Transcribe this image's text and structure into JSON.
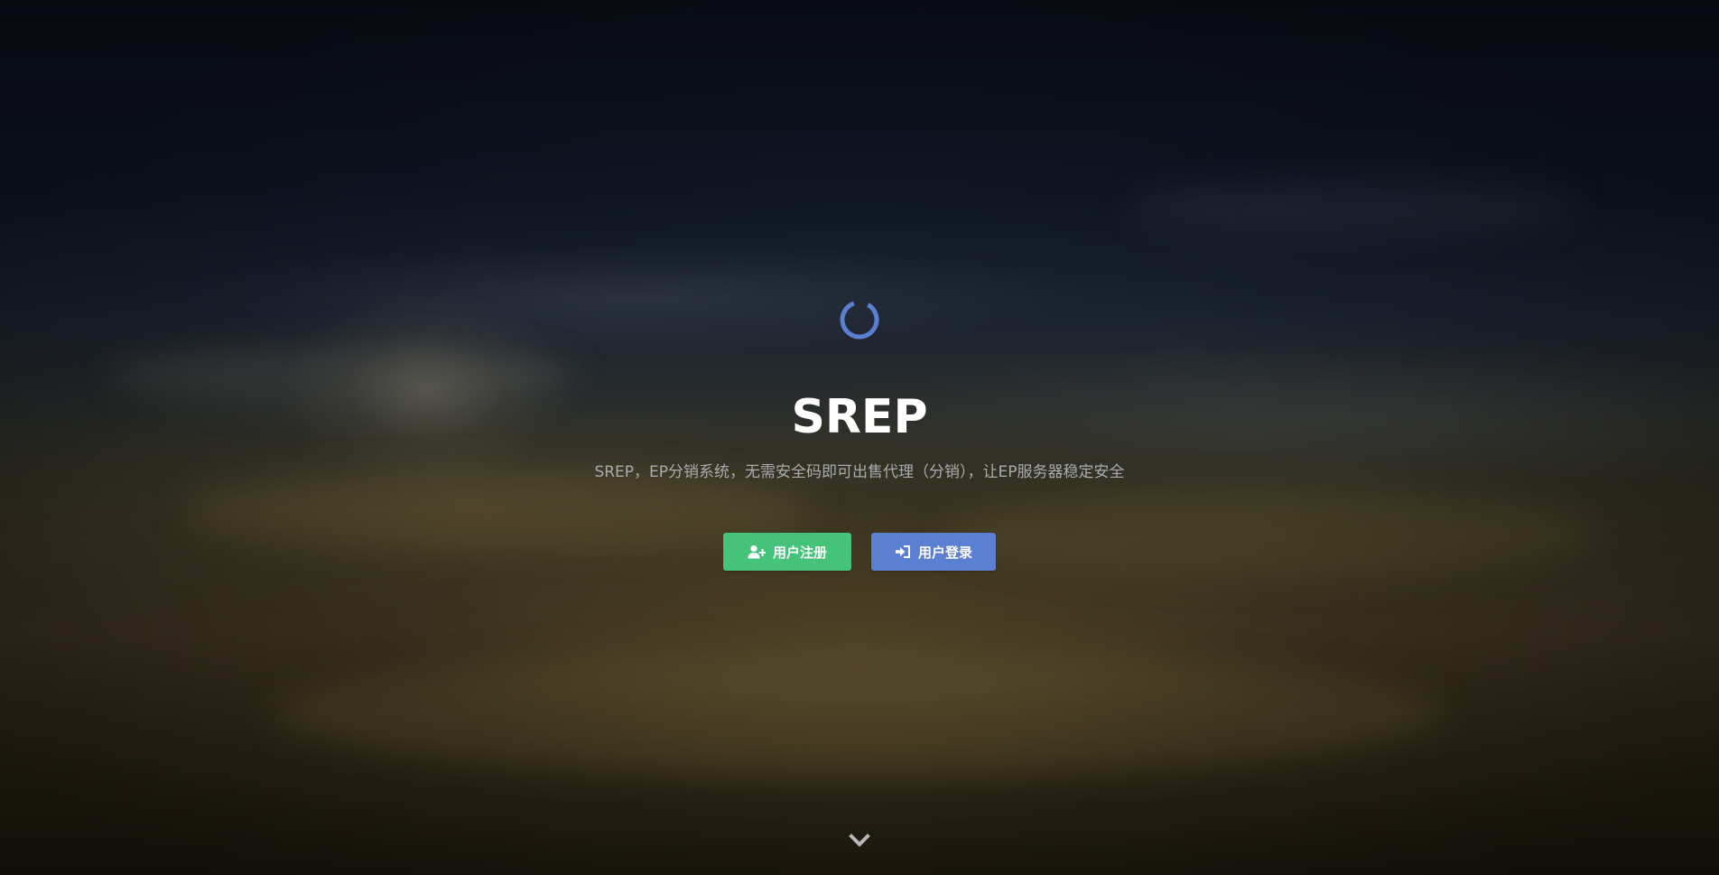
{
  "hero": {
    "title": "SREP",
    "subtitle": "SREP，EP分销系统，无需安全码即可出售代理（分销），让EP服务器稳定安全",
    "loading_icon": "spinner-icon",
    "scroll_icon": "chevron-down-icon"
  },
  "buttons": {
    "register": {
      "label": "用户注册",
      "icon": "user-plus-icon",
      "color": "#46c37b"
    },
    "login": {
      "label": "用户登录",
      "icon": "sign-in-icon",
      "color": "#5c80d1"
    }
  },
  "colors": {
    "spinner": "#5c80d1",
    "title": "#ffffff",
    "subtitle": "#a9acaf",
    "chevron": "#b8b8b8"
  }
}
